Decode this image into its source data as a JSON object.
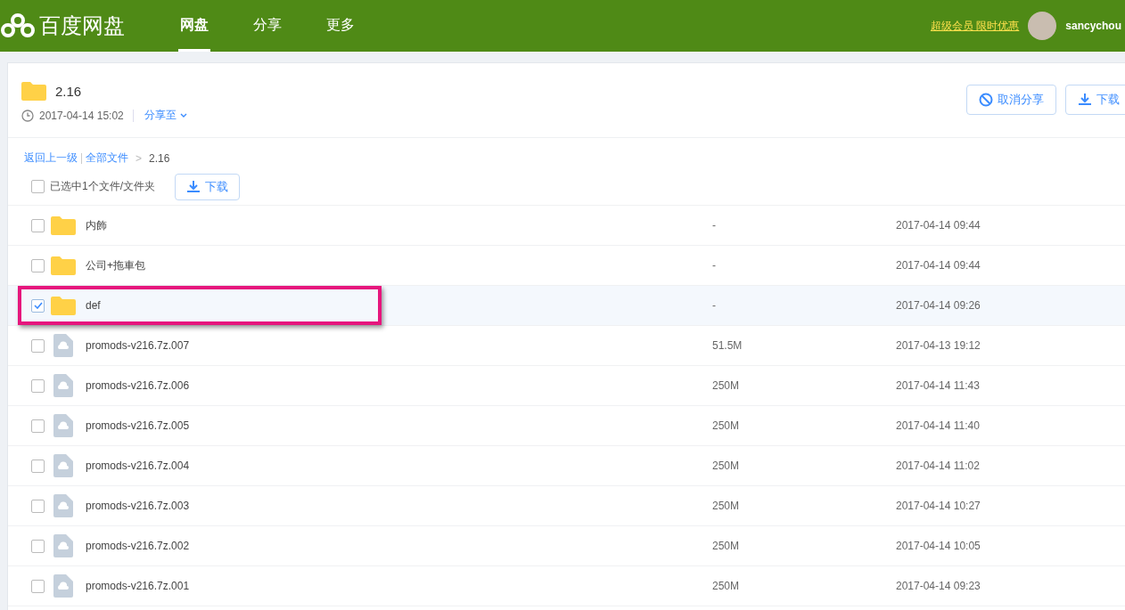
{
  "header": {
    "logo": "百度网盘",
    "nav": [
      {
        "label": "网盘",
        "selected": true
      },
      {
        "label": "分享",
        "selected": false
      },
      {
        "label": "更多",
        "selected": false
      }
    ],
    "promo": "超级会员 限时优惠",
    "username": "sancychou"
  },
  "share": {
    "title": "2.16",
    "time": "2017-04-14 15:02",
    "share_to": "分享至",
    "buttons": [
      {
        "kind": "cancel",
        "label": "取消分享"
      },
      {
        "kind": "download",
        "label": "下载"
      }
    ]
  },
  "breadcrumb": {
    "back": "返回上一级",
    "root": "全部文件",
    "separator": ">",
    "current": "2.16"
  },
  "selection": {
    "checked": false,
    "label": "已选中1个文件/文件夹",
    "download": "下载"
  },
  "rows": [
    {
      "kind": "folder",
      "name": "内飾",
      "size": "-",
      "date": "2017-04-14 09:44",
      "checked": false,
      "highlighted": false
    },
    {
      "kind": "folder",
      "name": "公司+拖車包",
      "size": "-",
      "date": "2017-04-14 09:44",
      "checked": false,
      "highlighted": false
    },
    {
      "kind": "folder",
      "name": "def",
      "size": "-",
      "date": "2017-04-14 09:26",
      "checked": true,
      "highlighted": true
    },
    {
      "kind": "file",
      "name": "promods-v216.7z.007",
      "size": "51.5M",
      "date": "2017-04-13 19:12",
      "checked": false,
      "highlighted": false
    },
    {
      "kind": "file",
      "name": "promods-v216.7z.006",
      "size": "250M",
      "date": "2017-04-14 11:43",
      "checked": false,
      "highlighted": false
    },
    {
      "kind": "file",
      "name": "promods-v216.7z.005",
      "size": "250M",
      "date": "2017-04-14 11:40",
      "checked": false,
      "highlighted": false
    },
    {
      "kind": "file",
      "name": "promods-v216.7z.004",
      "size": "250M",
      "date": "2017-04-14 11:02",
      "checked": false,
      "highlighted": false
    },
    {
      "kind": "file",
      "name": "promods-v216.7z.003",
      "size": "250M",
      "date": "2017-04-14 10:27",
      "checked": false,
      "highlighted": false
    },
    {
      "kind": "file",
      "name": "promods-v216.7z.002",
      "size": "250M",
      "date": "2017-04-14 10:05",
      "checked": false,
      "highlighted": false
    },
    {
      "kind": "file",
      "name": "promods-v216.7z.001",
      "size": "250M",
      "date": "2017-04-14 09:23",
      "checked": false,
      "highlighted": false
    }
  ]
}
